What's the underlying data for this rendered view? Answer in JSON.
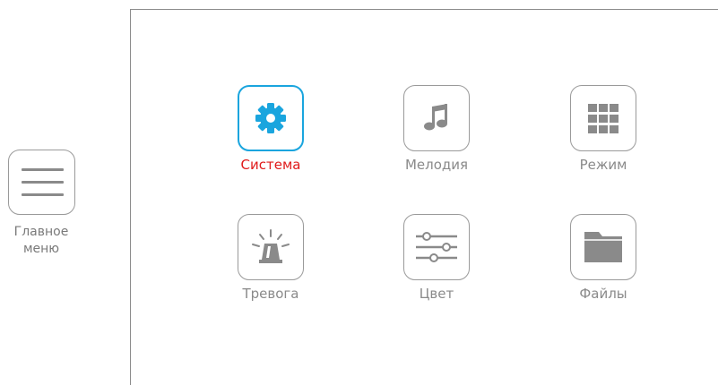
{
  "sidebar": {
    "main_menu_line1": "Главное",
    "main_menu_line2": "меню"
  },
  "menu": {
    "items": [
      {
        "label": "Система",
        "icon": "gear-icon",
        "selected": true
      },
      {
        "label": "Мелодия",
        "icon": "music-note-icon",
        "selected": false
      },
      {
        "label": "Режим",
        "icon": "grid-icon",
        "selected": false
      },
      {
        "label": "Тревога",
        "icon": "alarm-beacon-icon",
        "selected": false
      },
      {
        "label": "Цвет",
        "icon": "sliders-icon",
        "selected": false
      },
      {
        "label": "Файлы",
        "icon": "folder-icon",
        "selected": false
      }
    ]
  },
  "colors": {
    "selected_border": "#1aa5de",
    "selected_icon": "#1aa5de",
    "selected_label": "#e01b1b",
    "icon_gray": "#8a8a8a"
  }
}
